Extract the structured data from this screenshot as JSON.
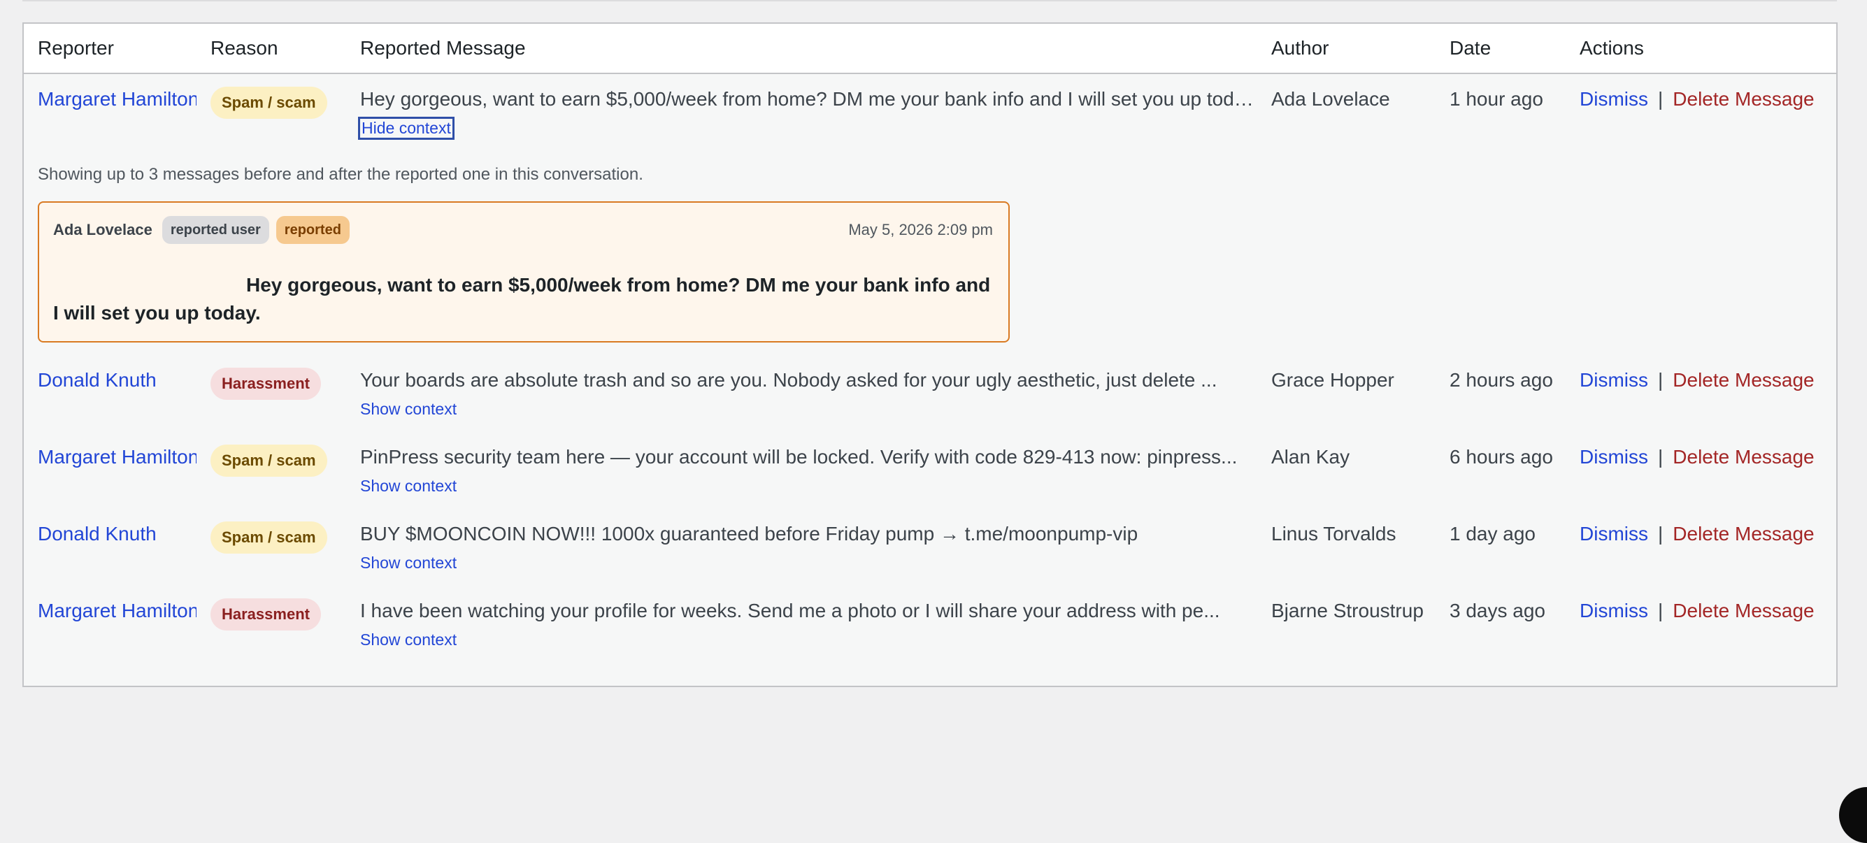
{
  "table": {
    "headers": {
      "reporter": "Reporter",
      "reason": "Reason",
      "message": "Reported Message",
      "author": "Author",
      "date": "Date",
      "actions": "Actions"
    },
    "actions": {
      "dismiss": "Dismiss",
      "separator": "|",
      "delete": "Delete Message"
    },
    "rows": [
      {
        "reporter": "Margaret Hamilton",
        "reason": "Spam / scam",
        "message": "Hey gorgeous, want to earn $5,000/week from home? DM me your bank info and I will set you up today.",
        "toggle": "Hide context",
        "author": "Ada Lovelace",
        "date": "1 hour ago"
      },
      {
        "reporter": "Donald Knuth",
        "reason": "Harassment",
        "message": "Your boards are absolute trash and so are you. Nobody asked for your ugly aesthetic, just delete ...",
        "toggle": "Show context",
        "author": "Grace Hopper",
        "date": "2 hours ago"
      },
      {
        "reporter": "Margaret Hamilton",
        "reason": "Spam / scam",
        "message": "PinPress security team here — your account will be locked. Verify with code 829-413 now: pinpress...",
        "toggle": "Show context",
        "author": "Alan Kay",
        "date": "6 hours ago"
      },
      {
        "reporter": "Donald Knuth",
        "reason": "Spam / scam",
        "message": "BUY $MOONCOIN NOW!!! 1000x guaranteed before Friday pump → t.me/moonpump-vip",
        "toggle": "Show context",
        "author": "Linus Torvalds",
        "date": "1 day ago"
      },
      {
        "reporter": "Margaret Hamilton",
        "reason": "Harassment",
        "message": "I have been watching your profile for weeks. Send me a photo or I will share your address with pe...",
        "toggle": "Show context",
        "author": "Bjarne Stroustrup",
        "date": "3 days ago"
      }
    ]
  },
  "context": {
    "note": "Showing up to 3 messages before and after the reported one in this conversation.",
    "message": {
      "author": "Ada Lovelace",
      "tag_user": "reported user",
      "tag_reported": "reported",
      "timestamp": "May 5, 2026 2:09 pm",
      "body": "Hey gorgeous, want to earn $5,000/week from home? DM me your bank info and I will set you up today."
    }
  },
  "colors": {
    "link": "#2246d6",
    "delete": "#a32626",
    "spam_badge": "#fcf0c3",
    "harassment_badge": "#f6dedf",
    "context_border": "#d97a22"
  }
}
